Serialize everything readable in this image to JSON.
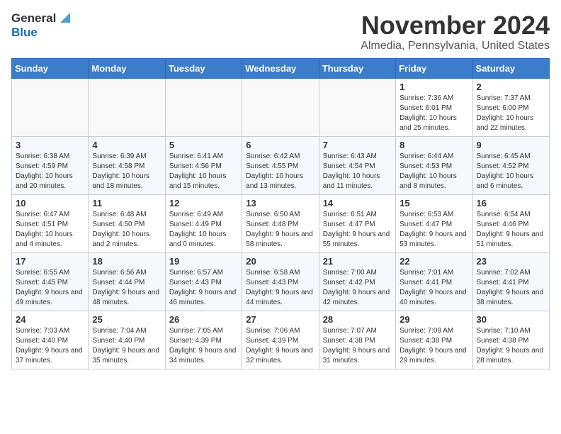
{
  "header": {
    "logo_general": "General",
    "logo_blue": "Blue",
    "title": "November 2024",
    "subtitle": "Almedia, Pennsylvania, United States"
  },
  "weekdays": [
    "Sunday",
    "Monday",
    "Tuesday",
    "Wednesday",
    "Thursday",
    "Friday",
    "Saturday"
  ],
  "weeks": [
    [
      {
        "day": "",
        "info": ""
      },
      {
        "day": "",
        "info": ""
      },
      {
        "day": "",
        "info": ""
      },
      {
        "day": "",
        "info": ""
      },
      {
        "day": "",
        "info": ""
      },
      {
        "day": "1",
        "info": "Sunrise: 7:36 AM\nSunset: 6:01 PM\nDaylight: 10 hours and 25 minutes."
      },
      {
        "day": "2",
        "info": "Sunrise: 7:37 AM\nSunset: 6:00 PM\nDaylight: 10 hours and 22 minutes."
      }
    ],
    [
      {
        "day": "3",
        "info": "Sunrise: 6:38 AM\nSunset: 4:59 PM\nDaylight: 10 hours and 20 minutes."
      },
      {
        "day": "4",
        "info": "Sunrise: 6:39 AM\nSunset: 4:58 PM\nDaylight: 10 hours and 18 minutes."
      },
      {
        "day": "5",
        "info": "Sunrise: 6:41 AM\nSunset: 4:56 PM\nDaylight: 10 hours and 15 minutes."
      },
      {
        "day": "6",
        "info": "Sunrise: 6:42 AM\nSunset: 4:55 PM\nDaylight: 10 hours and 13 minutes."
      },
      {
        "day": "7",
        "info": "Sunrise: 6:43 AM\nSunset: 4:54 PM\nDaylight: 10 hours and 11 minutes."
      },
      {
        "day": "8",
        "info": "Sunrise: 6:44 AM\nSunset: 4:53 PM\nDaylight: 10 hours and 8 minutes."
      },
      {
        "day": "9",
        "info": "Sunrise: 6:45 AM\nSunset: 4:52 PM\nDaylight: 10 hours and 6 minutes."
      }
    ],
    [
      {
        "day": "10",
        "info": "Sunrise: 6:47 AM\nSunset: 4:51 PM\nDaylight: 10 hours and 4 minutes."
      },
      {
        "day": "11",
        "info": "Sunrise: 6:48 AM\nSunset: 4:50 PM\nDaylight: 10 hours and 2 minutes."
      },
      {
        "day": "12",
        "info": "Sunrise: 6:49 AM\nSunset: 4:49 PM\nDaylight: 10 hours and 0 minutes."
      },
      {
        "day": "13",
        "info": "Sunrise: 6:50 AM\nSunset: 4:48 PM\nDaylight: 9 hours and 58 minutes."
      },
      {
        "day": "14",
        "info": "Sunrise: 6:51 AM\nSunset: 4:47 PM\nDaylight: 9 hours and 55 minutes."
      },
      {
        "day": "15",
        "info": "Sunrise: 6:53 AM\nSunset: 4:47 PM\nDaylight: 9 hours and 53 minutes."
      },
      {
        "day": "16",
        "info": "Sunrise: 6:54 AM\nSunset: 4:46 PM\nDaylight: 9 hours and 51 minutes."
      }
    ],
    [
      {
        "day": "17",
        "info": "Sunrise: 6:55 AM\nSunset: 4:45 PM\nDaylight: 9 hours and 49 minutes."
      },
      {
        "day": "18",
        "info": "Sunrise: 6:56 AM\nSunset: 4:44 PM\nDaylight: 9 hours and 48 minutes."
      },
      {
        "day": "19",
        "info": "Sunrise: 6:57 AM\nSunset: 4:43 PM\nDaylight: 9 hours and 46 minutes."
      },
      {
        "day": "20",
        "info": "Sunrise: 6:58 AM\nSunset: 4:43 PM\nDaylight: 9 hours and 44 minutes."
      },
      {
        "day": "21",
        "info": "Sunrise: 7:00 AM\nSunset: 4:42 PM\nDaylight: 9 hours and 42 minutes."
      },
      {
        "day": "22",
        "info": "Sunrise: 7:01 AM\nSunset: 4:41 PM\nDaylight: 9 hours and 40 minutes."
      },
      {
        "day": "23",
        "info": "Sunrise: 7:02 AM\nSunset: 4:41 PM\nDaylight: 9 hours and 38 minutes."
      }
    ],
    [
      {
        "day": "24",
        "info": "Sunrise: 7:03 AM\nSunset: 4:40 PM\nDaylight: 9 hours and 37 minutes."
      },
      {
        "day": "25",
        "info": "Sunrise: 7:04 AM\nSunset: 4:40 PM\nDaylight: 9 hours and 35 minutes."
      },
      {
        "day": "26",
        "info": "Sunrise: 7:05 AM\nSunset: 4:39 PM\nDaylight: 9 hours and 34 minutes."
      },
      {
        "day": "27",
        "info": "Sunrise: 7:06 AM\nSunset: 4:39 PM\nDaylight: 9 hours and 32 minutes."
      },
      {
        "day": "28",
        "info": "Sunrise: 7:07 AM\nSunset: 4:38 PM\nDaylight: 9 hours and 31 minutes."
      },
      {
        "day": "29",
        "info": "Sunrise: 7:09 AM\nSunset: 4:38 PM\nDaylight: 9 hours and 29 minutes."
      },
      {
        "day": "30",
        "info": "Sunrise: 7:10 AM\nSunset: 4:38 PM\nDaylight: 9 hours and 28 minutes."
      }
    ]
  ]
}
